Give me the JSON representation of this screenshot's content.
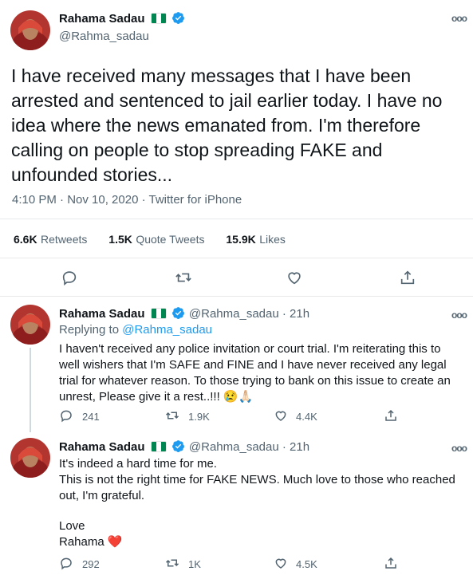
{
  "main_tweet": {
    "author_name": "Rahama Sadau",
    "handle": "@Rahma_sadau",
    "text": "I have received many messages that I have been arrested and sentenced to jail earlier today. I have no idea where the news emanated from. I'm therefore calling on people to stop spreading FAKE and unfounded stories...",
    "timestamp": "4:10 PM · Nov 10, 2020 · Twitter for iPhone",
    "stats": {
      "retweets_count": "6.6K",
      "retweets_label": "Retweets",
      "quotes_count": "1.5K",
      "quotes_label": "Quote Tweets",
      "likes_count": "15.9K",
      "likes_label": "Likes"
    }
  },
  "replies": [
    {
      "author_name": "Rahama Sadau",
      "handle_time": "@Rahma_sadau · 21h",
      "replying_prefix": "Replying to",
      "replying_to": "@Rahma_sadau",
      "text": "I haven't received any police invitation or court trial. I'm reiterating this to well wishers that I'm SAFE and FINE and I have never received any legal trial for whatever reason. To those trying to bank on this issue to create an unrest, Please give it a rest..!!! 😢🙏🏻",
      "replies": "241",
      "retweets": "1.9K",
      "likes": "4.4K"
    },
    {
      "author_name": "Rahama Sadau",
      "handle_time": "@Rahma_sadau · 21h",
      "text_line1": "It's indeed a hard time for me.",
      "text_line2": "This is not the right time for FAKE NEWS. Much love to those who reached out, I'm grateful.",
      "text_line3": "Love",
      "text_line4": "Rahama ❤️",
      "replies": "292",
      "retweets": "1K",
      "likes": "4.5K"
    }
  ],
  "colors": {
    "accent": "#1d9bf0",
    "muted": "#536471",
    "divider": "#e7e9ea",
    "flag_green": "#008751",
    "heart": "#e0245e"
  },
  "icons": [
    "verified-badge-icon",
    "nigeria-flag-icon",
    "more-options-icon",
    "reply-icon",
    "retweet-icon",
    "like-icon",
    "share-icon"
  ]
}
